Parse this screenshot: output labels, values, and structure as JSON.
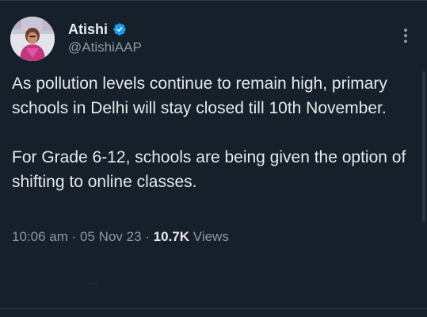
{
  "author": {
    "display_name": "Atishi",
    "handle": "@AtishiAAP",
    "avatar_icon": "profile-photo",
    "verified_icon": "verified-badge-icon",
    "verified_color": "#1d9bf0"
  },
  "tweet": {
    "paragraphs": [
      "As pollution levels continue to remain high, primary schools in Delhi will stay closed till 10th November.",
      "For Grade 6-12, schools are being given the option of shifting to online classes."
    ],
    "time": "10:06 am",
    "date": "05 Nov 23",
    "separator": "·",
    "views_count": "10.7K",
    "views_label": "Views"
  },
  "menu": {
    "icon": "more-vertical-icon"
  },
  "colors": {
    "background": "#15202b",
    "text_primary": "#e7e9ea",
    "text_secondary": "#8b98a5",
    "divider": "#2f3b47"
  }
}
